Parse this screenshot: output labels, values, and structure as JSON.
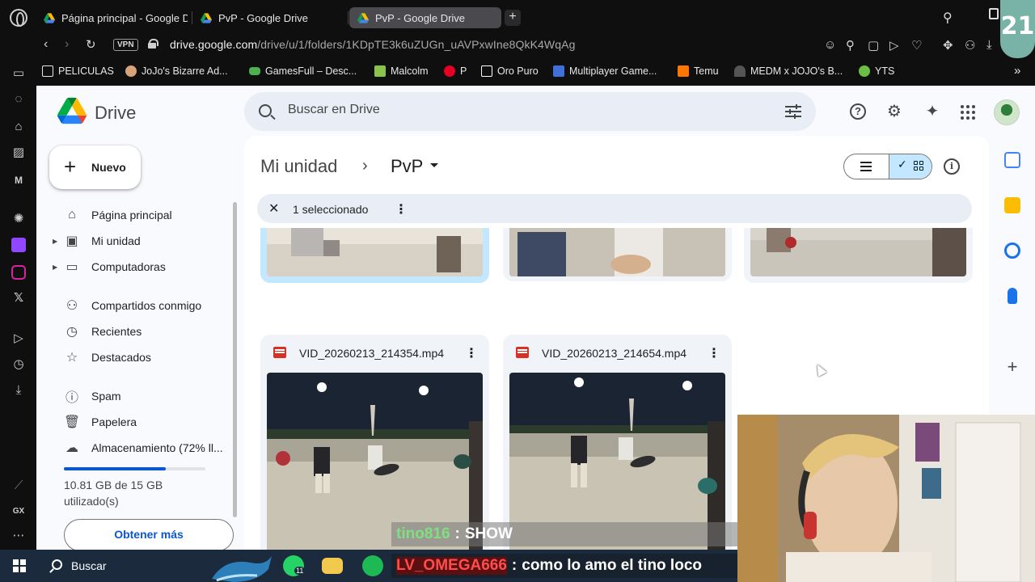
{
  "browser": {
    "tabs": [
      {
        "title": "Página principal - Google D",
        "active": false
      },
      {
        "title": "PvP - Google Drive",
        "active": false
      },
      {
        "title": "PvP - Google Drive",
        "active": true
      }
    ],
    "new_tab": "+",
    "address": {
      "vpn": "VPN",
      "host": "drive.google.com",
      "path": "/drive/u/1/folders/1KDpTE3k6uZUGn_uAVPxwIne8QkK4WqAg"
    },
    "bookmarks": [
      {
        "label": "PELICULAS",
        "icon": "folder-icon",
        "color": "#e8e8e8"
      },
      {
        "label": "JoJo's Bizarre Ad...",
        "icon": "jojo-icon",
        "color": "#d6a37a"
      },
      {
        "label": "GamesFull – Desc...",
        "icon": "gamepad-icon",
        "color": "#4caf50"
      },
      {
        "label": "Malcolm",
        "icon": "malcolm-icon",
        "color": "#8bc34a"
      },
      {
        "label": "P",
        "icon": "pinterest-icon",
        "color": "#e60023"
      },
      {
        "label": "Oro Puro",
        "icon": "notion-icon",
        "color": "#ffffff"
      },
      {
        "label": "Multiplayer Game...",
        "icon": "multiplayer-icon",
        "color": "#3f6fd8"
      },
      {
        "label": "Temu",
        "icon": "temu-icon",
        "color": "#fb7701"
      },
      {
        "label": "MEDM x JOJO's B...",
        "icon": "medm-icon",
        "color": "#555555"
      },
      {
        "label": "YTS",
        "icon": "yts-icon",
        "color": "#6ac045"
      }
    ],
    "overlay_badge": "21"
  },
  "drive": {
    "app_name": "Drive",
    "search_placeholder": "Buscar en Drive",
    "new_button": "Nuevo",
    "nav": [
      {
        "label": "Página principal",
        "icon": "home-icon",
        "expandable": false
      },
      {
        "label": "Mi unidad",
        "icon": "my-drive-icon",
        "expandable": true
      },
      {
        "label": "Computadoras",
        "icon": "computer-icon",
        "expandable": true
      },
      {
        "label": "Compartidos conmigo",
        "icon": "shared-icon",
        "expandable": false
      },
      {
        "label": "Recientes",
        "icon": "clock-icon",
        "expandable": false
      },
      {
        "label": "Destacados",
        "icon": "star-icon",
        "expandable": false
      },
      {
        "label": "Spam",
        "icon": "spam-icon",
        "expandable": false
      },
      {
        "label": "Papelera",
        "icon": "trash-icon",
        "expandable": false
      },
      {
        "label": "Almacenamiento (72% ll...",
        "icon": "cloud-icon",
        "expandable": false
      }
    ],
    "storage": {
      "used_fraction": 0.72,
      "text": "10.81 GB de 15 GB utilizado(s)",
      "get_more": "Obtener más"
    },
    "breadcrumb": {
      "root": "Mi unidad",
      "separator": "›",
      "current": "PvP"
    },
    "selection": {
      "text": "1 seleccionado"
    },
    "files": [
      {
        "name": "",
        "selected": true
      },
      {
        "name": "",
        "selected": false
      },
      {
        "name": "",
        "selected": false
      },
      {
        "name": "VID_20260213_214354.mp4",
        "selected": false
      },
      {
        "name": "VID_20260213_214654.mp4",
        "selected": false
      }
    ]
  },
  "taskbar": {
    "search": "Buscar",
    "whatsapp_badge": "11"
  },
  "stream": {
    "chat": [
      {
        "user": "tino816",
        "sep": ":",
        "message": "SHOW",
        "user_color": "#7fe07f"
      },
      {
        "user": "LV_OMEGA666",
        "sep": ":",
        "message": "como lo amo el tino loco",
        "user_color": "#ff4d4d"
      }
    ]
  }
}
